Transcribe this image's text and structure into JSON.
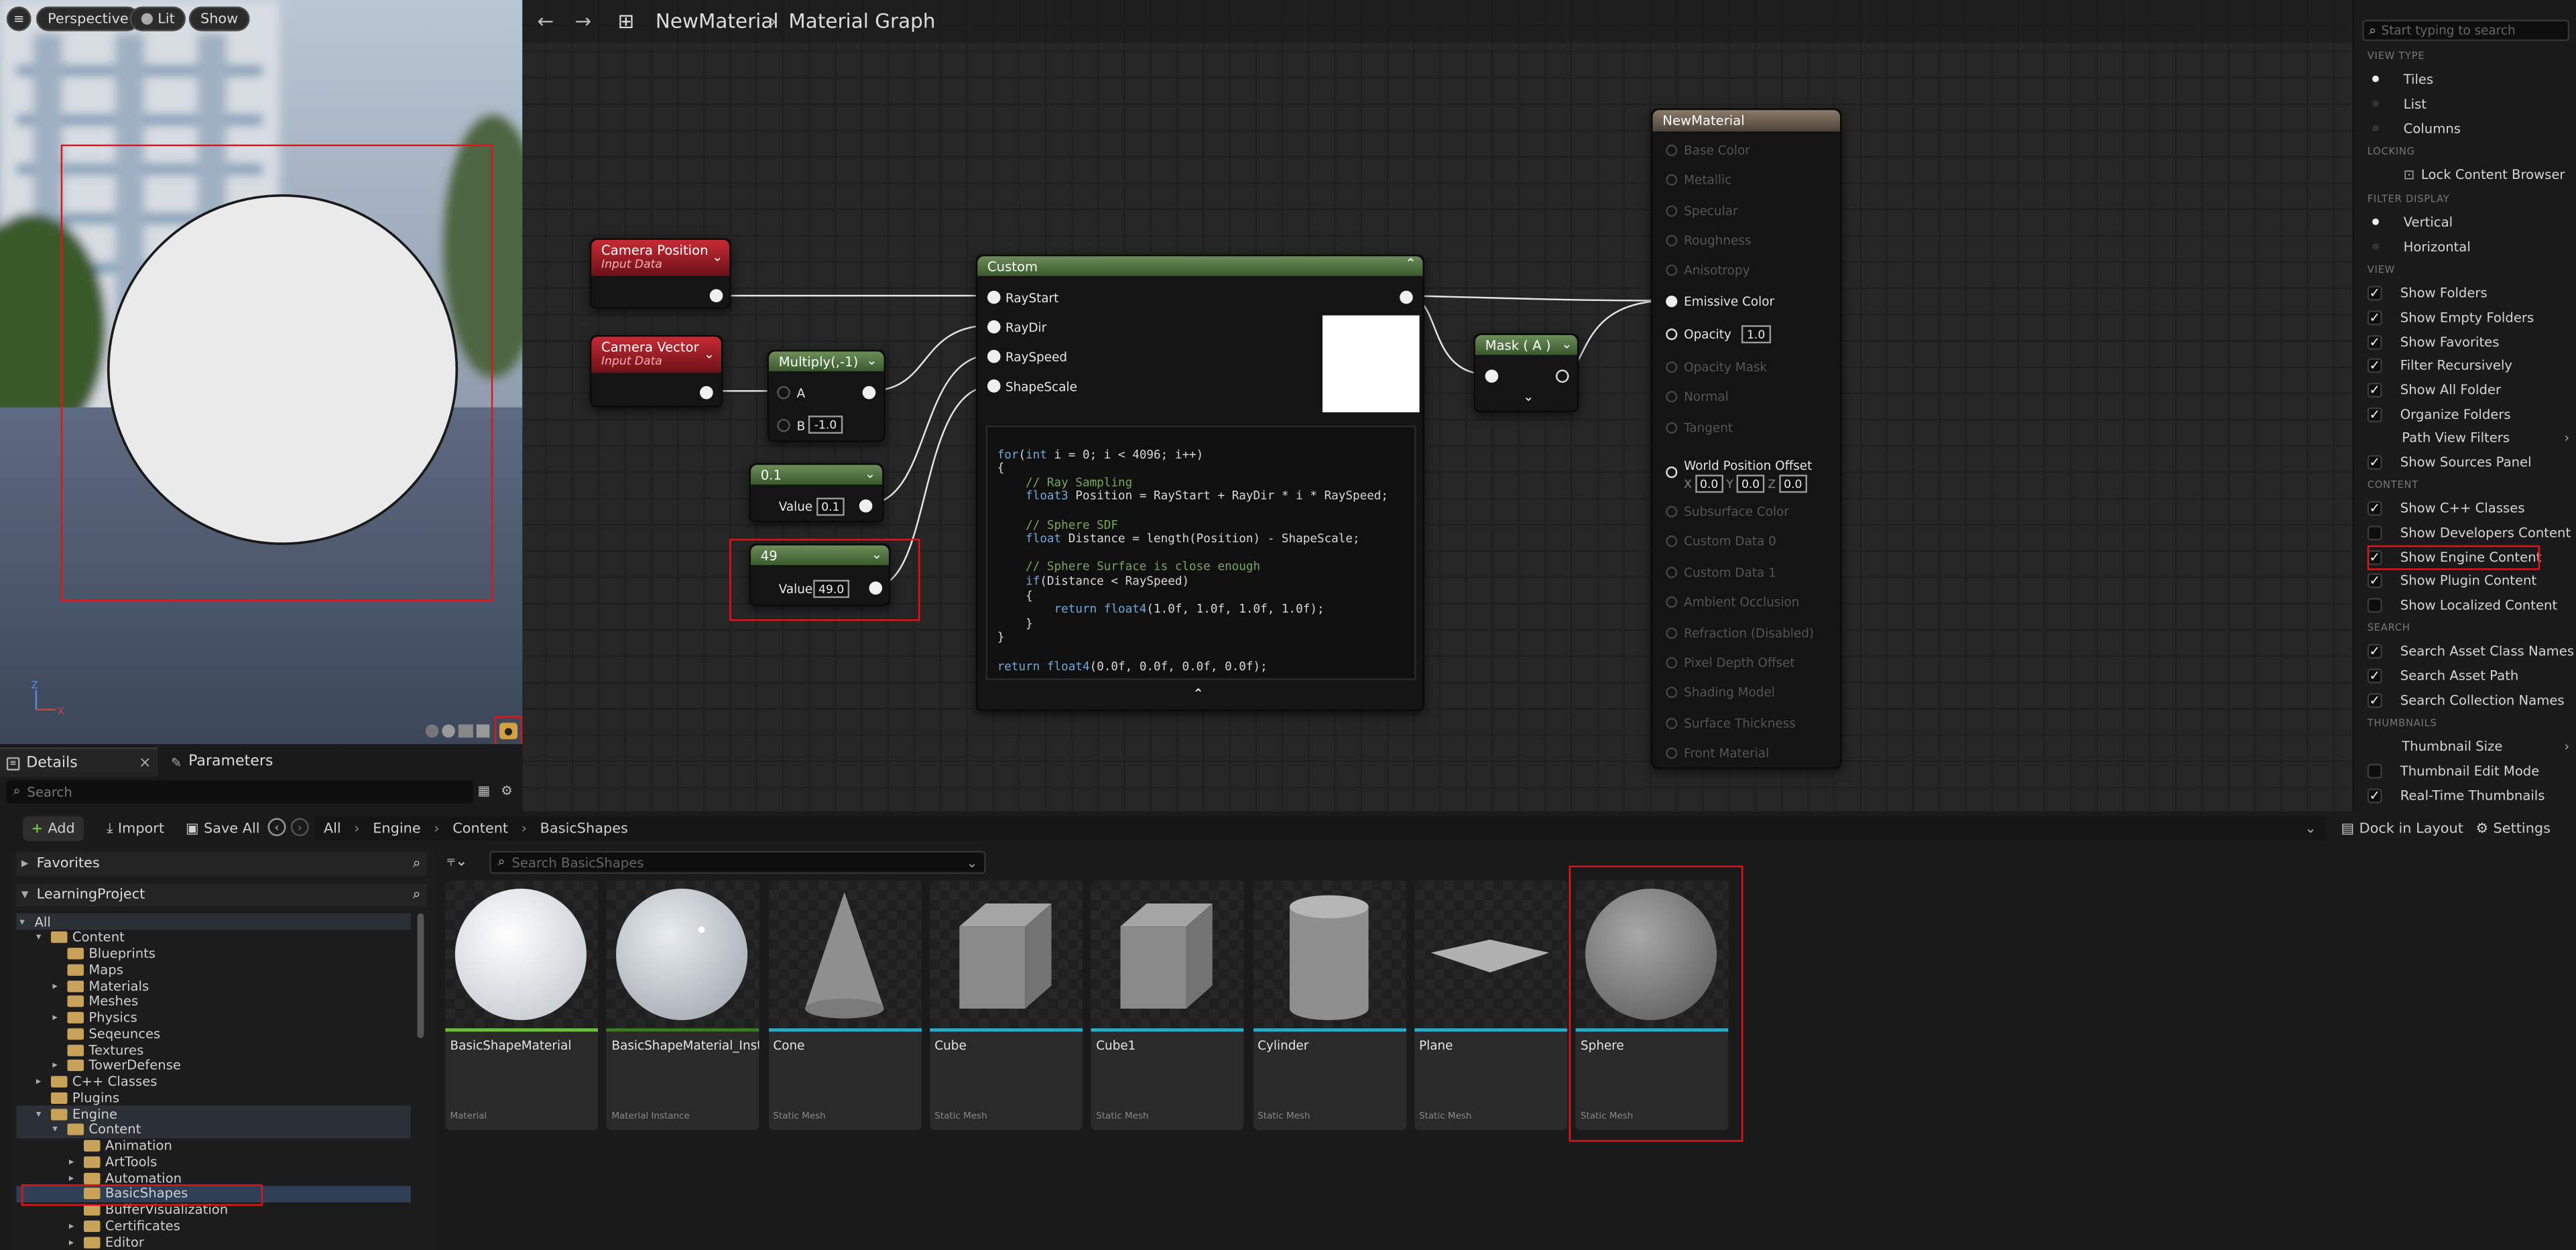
{
  "viewport": {
    "menu_icon": "hamburger-icon",
    "perspective_label": "Perspective",
    "lit_label": "Lit",
    "show_label": "Show"
  },
  "tabs": {
    "details": "Details",
    "parameters": "Parameters",
    "close": "×",
    "search_placeholder": "Search"
  },
  "graph_header": {
    "breadcrumb_root": "NewMaterial",
    "separator": "›",
    "breadcrumb_page": "Material Graph"
  },
  "nodes": {
    "camera_position": {
      "title": "Camera Position",
      "subtitle": "Input Data"
    },
    "camera_vector": {
      "title": "Camera Vector",
      "subtitle": "Input Data"
    },
    "multiply": {
      "title": "Multiply(,-1)",
      "a_label": "A",
      "b_label": "B",
      "b_value": "-1.0"
    },
    "const_01": {
      "title": "0.1",
      "value_label": "Value",
      "value": "0.1"
    },
    "const_49": {
      "title": "49",
      "value_label": "Value",
      "value": "49.0"
    },
    "custom": {
      "title": "Custom",
      "inputs": [
        "RayStart",
        "RayDir",
        "RaySpeed",
        "ShapeScale"
      ],
      "code": [
        "for(int i = 0; i < 4096; i++)",
        "{",
        "    // Ray Sampling",
        "    float3 Position = RayStart + RayDir * i * RaySpeed;",
        "",
        "    // Sphere SDF",
        "    float Distance = length(Position) - ShapeScale;",
        "",
        "    // Sphere Surface is close enough",
        "    if(Distance < RaySpeed)",
        "    {",
        "        return float4(1.0f, 1.0f, 1.0f, 1.0f);",
        "    }",
        "}",
        "",
        "return float4(0.0f, 0.0f, 0.0f, 0.0f);"
      ]
    },
    "mask": {
      "title": "Mask ( A )"
    },
    "new_material": {
      "title": "NewMaterial",
      "rows": [
        "Base Color",
        "Metallic",
        "Specular",
        "Roughness",
        "Anisotropy",
        "Emissive Color",
        "Opacity",
        "Opacity Mask",
        "Normal",
        "Tangent",
        "World Position Offset",
        "Subsurface Color",
        "Custom Data 0",
        "Custom Data 1",
        "Ambient Occlusion",
        "Refraction (Disabled)",
        "Pixel Depth Offset",
        "Shading Model",
        "Surface Thickness",
        "Front Material"
      ],
      "opacity_value": "1.0",
      "wpo": {
        "x_label": "X",
        "x": "0.0",
        "y_label": "Y",
        "y": "0.0",
        "z_label": "Z",
        "z": "0.0"
      }
    }
  },
  "settings_menu": {
    "search_placeholder": "Start typing to search",
    "view_type_header": "VIEW TYPE",
    "view_types": [
      "Tiles",
      "List",
      "Columns"
    ],
    "locking_header": "LOCKING",
    "lock_label": "Lock Content Browser",
    "filter_display_header": "FILTER DISPLAY",
    "filter_displays": [
      "Vertical",
      "Horizontal"
    ],
    "view_header": "VIEW",
    "view_items": [
      {
        "label": "Show Folders",
        "checked": true
      },
      {
        "label": "Show Empty Folders",
        "checked": true
      },
      {
        "label": "Show Favorites",
        "checked": true
      },
      {
        "label": "Filter Recursively",
        "checked": true
      },
      {
        "label": "Show All Folder",
        "checked": true
      },
      {
        "label": "Organize Folders",
        "checked": true
      }
    ],
    "path_view_filters": "Path View Filters",
    "show_sources_panel": "Show Sources Panel",
    "content_header": "CONTENT",
    "content_items": [
      {
        "label": "Show C++ Classes",
        "checked": true
      },
      {
        "label": "Show Developers Content",
        "checked": false
      },
      {
        "label": "Show Engine Content",
        "checked": true
      },
      {
        "label": "Show Plugin Content",
        "checked": true
      },
      {
        "label": "Show Localized Content",
        "checked": false
      }
    ],
    "search_header": "SEARCH",
    "search_items": [
      {
        "label": "Search Asset Class Names",
        "checked": true
      },
      {
        "label": "Search Asset Path",
        "checked": true
      },
      {
        "label": "Search Collection Names",
        "checked": true
      }
    ],
    "thumbnails_header": "THUMBNAILS",
    "thumbnail_size": "Thumbnail Size",
    "thumbnail_edit_mode": "Thumbnail Edit Mode",
    "realtime_thumbnails": "Real-Time Thumbnails",
    "check_glyph": "✓"
  },
  "content_browser": {
    "add_label": "Add",
    "import_label": "Import",
    "save_all_label": "Save All",
    "path": [
      "All",
      "Engine",
      "Content",
      "BasicShapes"
    ],
    "path_sep": "›",
    "dock_label": "Dock in Layout",
    "settings_label": "Settings",
    "search_placeholder": "Search BasicShapes",
    "favorites_label": "Favorites",
    "project_label": "LearningProject",
    "tree": [
      {
        "label": "All",
        "depth": 0,
        "arrow": "▾",
        "folder": false
      },
      {
        "label": "Content",
        "depth": 1,
        "arrow": "▾",
        "folder": true
      },
      {
        "label": "Blueprints",
        "depth": 2,
        "arrow": "",
        "folder": true
      },
      {
        "label": "Maps",
        "depth": 2,
        "arrow": "",
        "folder": true
      },
      {
        "label": "Materials",
        "depth": 2,
        "arrow": "▸",
        "folder": true
      },
      {
        "label": "Meshes",
        "depth": 2,
        "arrow": "",
        "folder": true
      },
      {
        "label": "Physics",
        "depth": 2,
        "arrow": "▸",
        "folder": true
      },
      {
        "label": "Seqeunces",
        "depth": 2,
        "arrow": "",
        "folder": true
      },
      {
        "label": "Textures",
        "depth": 2,
        "arrow": "",
        "folder": true
      },
      {
        "label": "TowerDefense",
        "depth": 2,
        "arrow": "▸",
        "folder": true
      },
      {
        "label": "C++ Classes",
        "depth": 1,
        "arrow": "▸",
        "folder": true
      },
      {
        "label": "Plugins",
        "depth": 1,
        "arrow": "",
        "folder": true
      },
      {
        "label": "Engine",
        "depth": 1,
        "arrow": "▾",
        "folder": true
      },
      {
        "label": "Content",
        "depth": 2,
        "arrow": "▾",
        "folder": true
      },
      {
        "label": "Animation",
        "depth": 3,
        "arrow": "",
        "folder": true
      },
      {
        "label": "ArtTools",
        "depth": 3,
        "arrow": "▸",
        "folder": true
      },
      {
        "label": "Automation",
        "depth": 3,
        "arrow": "▸",
        "folder": true
      },
      {
        "label": "BasicShapes",
        "depth": 3,
        "arrow": "",
        "folder": true
      },
      {
        "label": "BufferVisualization",
        "depth": 3,
        "arrow": "",
        "folder": true
      },
      {
        "label": "Certificates",
        "depth": 3,
        "arrow": "▸",
        "folder": true
      },
      {
        "label": "Editor",
        "depth": 3,
        "arrow": "▸",
        "folder": true
      }
    ],
    "assets": [
      {
        "name": "BasicShapeMaterial",
        "type": "Material",
        "bar": "#6bbf3a"
      },
      {
        "name": "BasicShapeMaterial_Inst",
        "type": "Material Instance",
        "bar": "#3d7a24"
      },
      {
        "name": "Cone",
        "type": "Static Mesh",
        "bar": "#2aa9c9"
      },
      {
        "name": "Cube",
        "type": "Static Mesh",
        "bar": "#2aa9c9"
      },
      {
        "name": "Cube1",
        "type": "Static Mesh",
        "bar": "#2aa9c9"
      },
      {
        "name": "Cylinder",
        "type": "Static Mesh",
        "bar": "#2aa9c9"
      },
      {
        "name": "Plane",
        "type": "Static Mesh",
        "bar": "#2aa9c9"
      },
      {
        "name": "Sphere",
        "type": "Static Mesh",
        "bar": "#2aa9c9"
      }
    ]
  },
  "colors": {
    "highlight": "#e0141a",
    "accent": "#2aa9c9",
    "selected_row": "#2f3f55"
  }
}
